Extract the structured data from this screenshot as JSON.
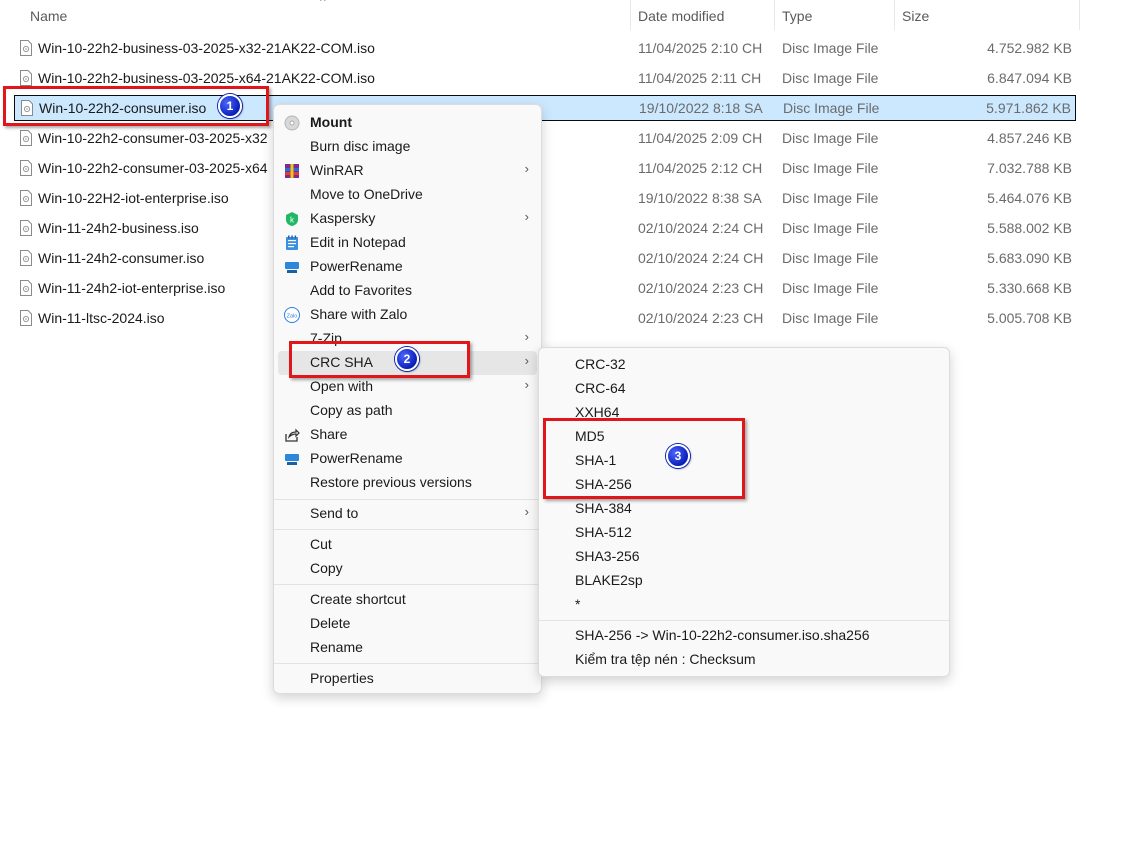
{
  "columns": {
    "name": "Name",
    "date_modified": "Date modified",
    "type": "Type",
    "size": "Size"
  },
  "files": [
    {
      "name": "Win-10-22h2-business-03-2025-x32-21AK22-COM.iso",
      "date": "11/04/2025 2:10 CH",
      "type": "Disc Image File",
      "size": "4.752.982 KB"
    },
    {
      "name": "Win-10-22h2-business-03-2025-x64-21AK22-COM.iso",
      "date": "11/04/2025 2:11 CH",
      "type": "Disc Image File",
      "size": "6.847.094 KB"
    },
    {
      "name": "Win-10-22h2-consumer.iso",
      "date": "19/10/2022 8:18 SA",
      "type": "Disc Image File",
      "size": "5.971.862 KB"
    },
    {
      "name": "Win-10-22h2-consumer-03-2025-x32",
      "date": "11/04/2025 2:09 CH",
      "type": "Disc Image File",
      "size": "4.857.246 KB"
    },
    {
      "name": "Win-10-22h2-consumer-03-2025-x64",
      "date": "11/04/2025 2:12 CH",
      "type": "Disc Image File",
      "size": "7.032.788 KB"
    },
    {
      "name": "Win-10-22H2-iot-enterprise.iso",
      "date": "19/10/2022 8:38 SA",
      "type": "Disc Image File",
      "size": "5.464.076 KB"
    },
    {
      "name": "Win-11-24h2-business.iso",
      "date": "02/10/2024 2:24 CH",
      "type": "Disc Image File",
      "size": "5.588.002 KB"
    },
    {
      "name": "Win-11-24h2-consumer.iso",
      "date": "02/10/2024 2:24 CH",
      "type": "Disc Image File",
      "size": "5.683.090 KB"
    },
    {
      "name": "Win-11-24h2-iot-enterprise.iso",
      "date": "02/10/2024 2:23 CH",
      "type": "Disc Image File",
      "size": "5.330.668 KB"
    },
    {
      "name": "Win-11-ltsc-2024.iso",
      "date": "02/10/2024 2:23 CH",
      "type": "Disc Image File",
      "size": "5.005.708 KB"
    }
  ],
  "context_menu": {
    "mount": "Mount",
    "burn": "Burn disc image",
    "winrar": "WinRAR",
    "onedrive": "Move to OneDrive",
    "kaspersky": "Kaspersky",
    "notepad": "Edit in Notepad",
    "powerrename": "PowerRename",
    "favorites": "Add to Favorites",
    "zalo": "Share with Zalo",
    "sevenzip": "7-Zip",
    "crcsha": "CRC SHA",
    "openwith": "Open with",
    "copypath": "Copy as path",
    "share": "Share",
    "powerrename2": "PowerRename",
    "restore": "Restore previous versions",
    "sendto": "Send to",
    "cut": "Cut",
    "copy": "Copy",
    "shortcut": "Create shortcut",
    "delete": "Delete",
    "rename": "Rename",
    "properties": "Properties"
  },
  "submenu": {
    "items": [
      "CRC-32",
      "CRC-64",
      "XXH64",
      "MD5",
      "SHA-1",
      "SHA-256",
      "SHA-384",
      "SHA-512",
      "SHA3-256",
      "BLAKE2sp",
      "*"
    ],
    "sha256_file": "SHA-256 -> Win-10-22h2-consumer.iso.sha256",
    "checksum": "Kiểm tra tệp nén : Checksum"
  },
  "badges": {
    "b1": "1",
    "b2": "2",
    "b3": "3"
  },
  "colors": {
    "selection": "#cce8ff",
    "highlight_red": "#e0161b",
    "badge_blue": "#0a1fb8"
  },
  "icons": {
    "file": "disc-image-file-icon",
    "mount": "disc-icon",
    "winrar": "winrar-icon",
    "kaspersky": "kaspersky-icon",
    "notepad": "notepad-icon",
    "powerrename": "powerrename-icon",
    "zalo": "zalo-icon",
    "share": "share-icon"
  }
}
